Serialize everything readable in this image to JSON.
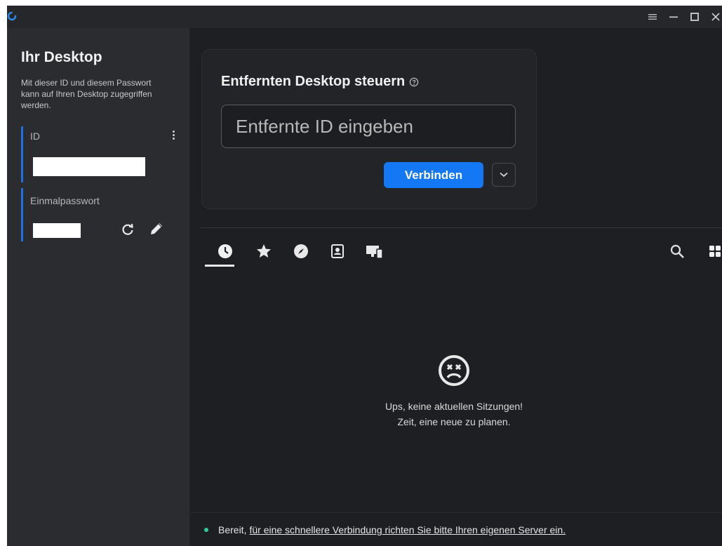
{
  "titlebar": {
    "icons": [
      "app-logo-icon",
      "menu-icon",
      "minimize-icon",
      "maximize-icon",
      "close-icon"
    ]
  },
  "sidebar": {
    "title": "Ihr Desktop",
    "description": "Mit dieser ID und diesem Passwort kann auf Ihren Desktop zugegriffen werden.",
    "id_label": "ID",
    "id_value": "",
    "password_label": "Einmalpasswort",
    "password_value": "",
    "accent_color": "#1f6fe0"
  },
  "connect": {
    "title": "Entfernten Desktop steuern",
    "input_placeholder": "Entfernte ID eingeben",
    "input_value": "",
    "button_label": "Verbinden",
    "button_color": "#1478f4"
  },
  "tabs": [
    {
      "name": "recent-sessions",
      "icon": "clock-icon",
      "active": true
    },
    {
      "name": "favorites",
      "icon": "star-icon",
      "active": false
    },
    {
      "name": "discovered",
      "icon": "compass-icon",
      "active": false
    },
    {
      "name": "address-book",
      "icon": "contact-icon",
      "active": false
    },
    {
      "name": "devices",
      "icon": "devices-icon",
      "active": false
    }
  ],
  "empty_state": {
    "icon": "sad-face-icon",
    "line1": "Ups, keine aktuellen Sitzungen!",
    "line2": "Zeit, eine neue zu planen."
  },
  "status": {
    "prefix": "Bereit,",
    "link_text": "für eine schnellere Verbindung richten Sie bitte Ihren eigenen Server ein.",
    "dot_color": "#2ecc9a"
  }
}
